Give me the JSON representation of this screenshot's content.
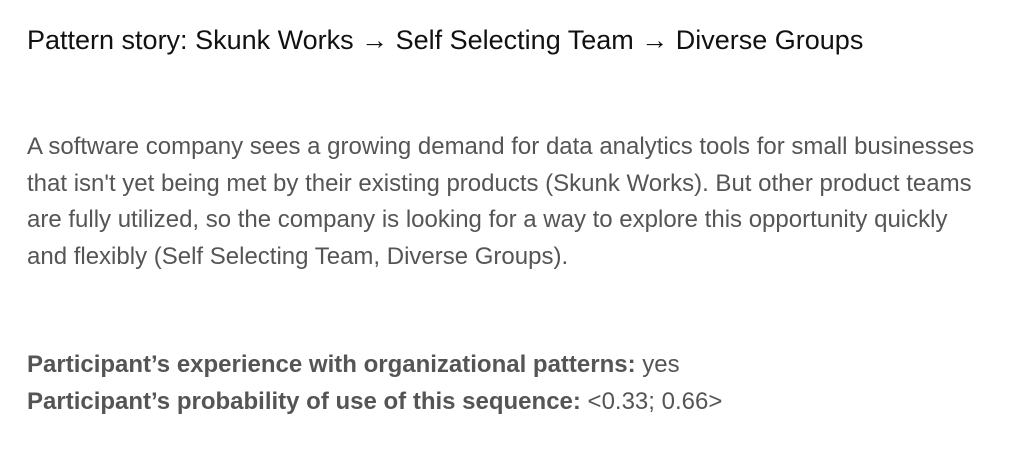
{
  "title": "Pattern story: Skunk Works → Self Selecting Team → Diverse Groups",
  "story": "A software company sees a growing demand for data analytics tools for small businesses that isn't yet being met by their existing products (Skunk Works). But other product teams are fully utilized, so the company is looking for a way to explore this opportunity quickly and flexibly (Self Selecting Team, Diverse Groups).",
  "experience": {
    "label": "Participant’s experience with organizational patterns:",
    "value": "yes"
  },
  "probability": {
    "label": "Participant’s probability of use of this sequence:",
    "value": "<0.33; 0.66>"
  }
}
